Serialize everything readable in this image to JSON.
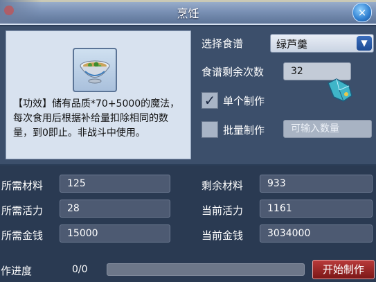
{
  "window": {
    "title": "烹饪",
    "close_glyph": "×"
  },
  "item": {
    "icon": "soup-bowl-icon",
    "description": "【功效】储有品质*70+5000的魔法，每次食用后根据补给量扣除相同的数量，到0即止。非战斗中使用。"
  },
  "recipe": {
    "select_label": "选择食谱",
    "selected": "绿芦羹",
    "remaining_label": "食谱剩余次数",
    "remaining_value": "32"
  },
  "options": {
    "single_label": "单个制作",
    "single_checked": true,
    "batch_label": "批量制作",
    "batch_checked": false,
    "batch_placeholder": "可输入数量"
  },
  "stats": {
    "required_material_label": "所需材料",
    "required_material": "125",
    "remaining_material_label": "剩余材料",
    "remaining_material": "933",
    "required_energy_label": "所需活力",
    "required_energy": "28",
    "current_energy_label": "当前活力",
    "current_energy": "1161",
    "required_money_label": "所需金钱",
    "required_money": "15000",
    "current_money_label": "当前金钱",
    "current_money": "3034000"
  },
  "progress": {
    "label": "制作进度",
    "value_text": "0/0",
    "fraction": 0
  },
  "start_button": "开始制作",
  "colors": {
    "accent_red": "#9a2525",
    "select_arrow": "#1d4b94"
  }
}
